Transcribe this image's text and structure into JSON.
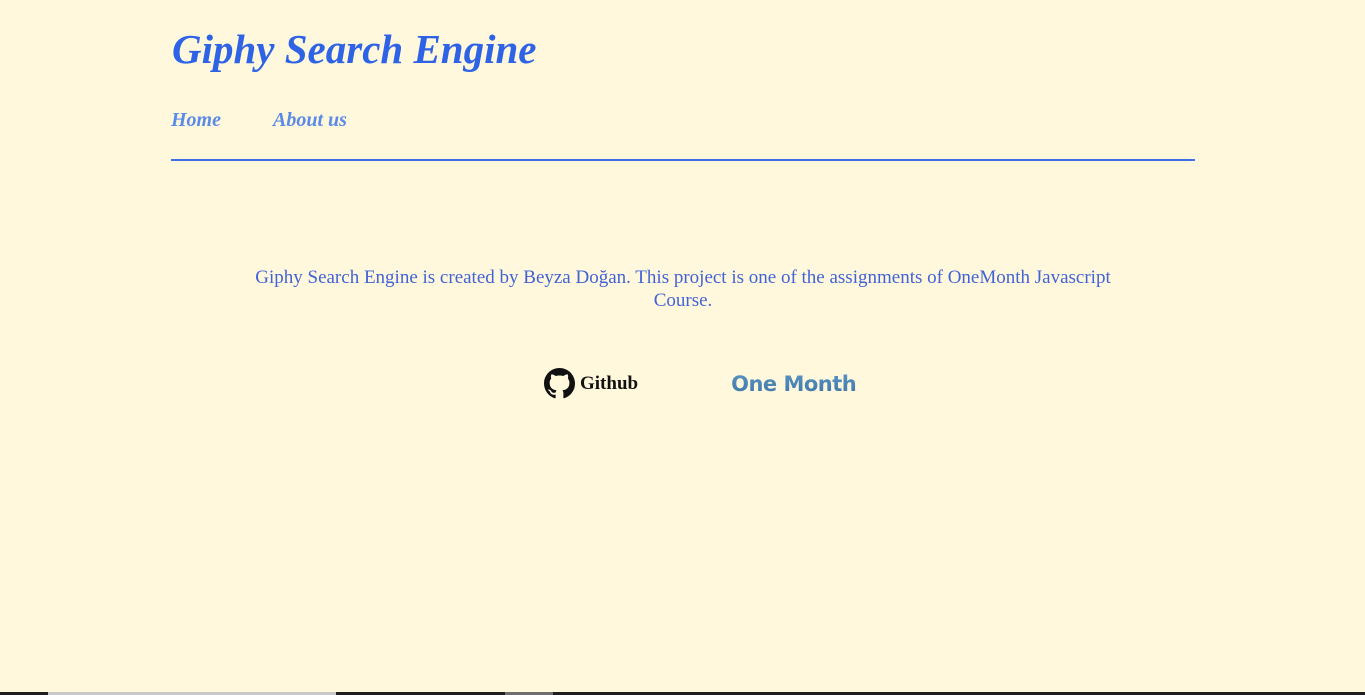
{
  "header": {
    "title": "Giphy Search Engine"
  },
  "nav": {
    "items": [
      {
        "label": "Home"
      },
      {
        "label": "About us"
      }
    ]
  },
  "main": {
    "description": "Giphy Search Engine is created by Beyza Doğan. This project is one of the assignments of OneMonth Javascript Course."
  },
  "links": {
    "github": {
      "label": "Github",
      "icon": "github-icon"
    },
    "onemonth": {
      "logo_text": "One Month",
      "icon": "onemonth-logo"
    }
  },
  "colors": {
    "background": "#fff8dc",
    "title": "#2e63e6",
    "nav": "#5b8be6",
    "divider": "#3e6fe8",
    "text": "#4263d6"
  }
}
